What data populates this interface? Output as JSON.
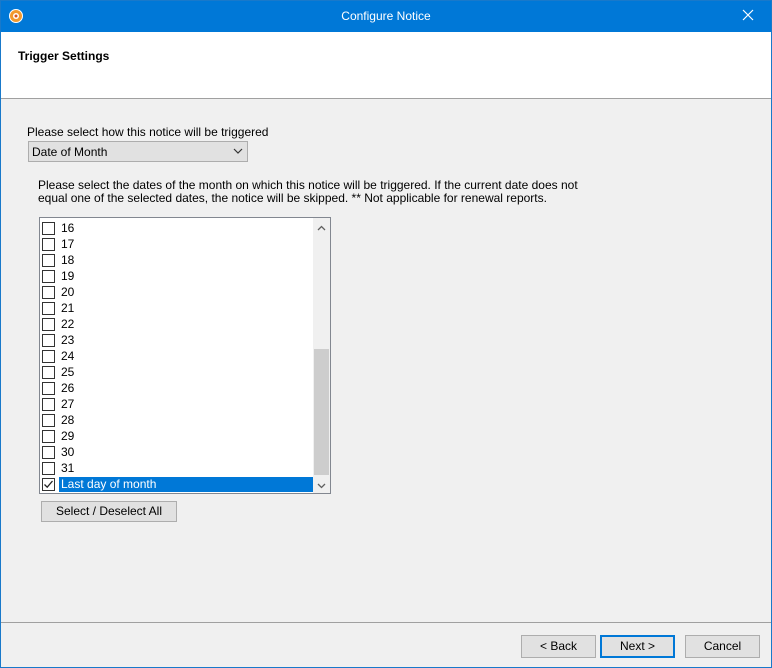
{
  "window": {
    "title": "Configure Notice",
    "close_glyph": "✕"
  },
  "header": {
    "title": "Trigger Settings"
  },
  "trigger": {
    "label": "Please select how this notice will be triggered",
    "selected": "Date of Month"
  },
  "description": {
    "line1": "Please select the dates of the month on which this notice will be triggered. If the current date does not",
    "line2": "equal one of the selected dates, the notice will be skipped.  ** Not applicable for renewal reports."
  },
  "dates_list": {
    "items": [
      {
        "label": "16",
        "checked": false
      },
      {
        "label": "17",
        "checked": false
      },
      {
        "label": "18",
        "checked": false
      },
      {
        "label": "19",
        "checked": false
      },
      {
        "label": "20",
        "checked": false
      },
      {
        "label": "21",
        "checked": false
      },
      {
        "label": "22",
        "checked": false
      },
      {
        "label": "23",
        "checked": false
      },
      {
        "label": "24",
        "checked": false
      },
      {
        "label": "25",
        "checked": false
      },
      {
        "label": "26",
        "checked": false
      },
      {
        "label": "27",
        "checked": false
      },
      {
        "label": "28",
        "checked": false
      },
      {
        "label": "29",
        "checked": false
      },
      {
        "label": "30",
        "checked": false
      },
      {
        "label": "31",
        "checked": false
      },
      {
        "label": "Last day of month",
        "checked": true,
        "selected": true
      }
    ]
  },
  "select_all_button": "Select / Deselect All",
  "footer": {
    "back": "< Back",
    "next": "Next >",
    "cancel": "Cancel"
  },
  "colors": {
    "title_bar": "#0078d7",
    "selection": "#0078d7"
  }
}
